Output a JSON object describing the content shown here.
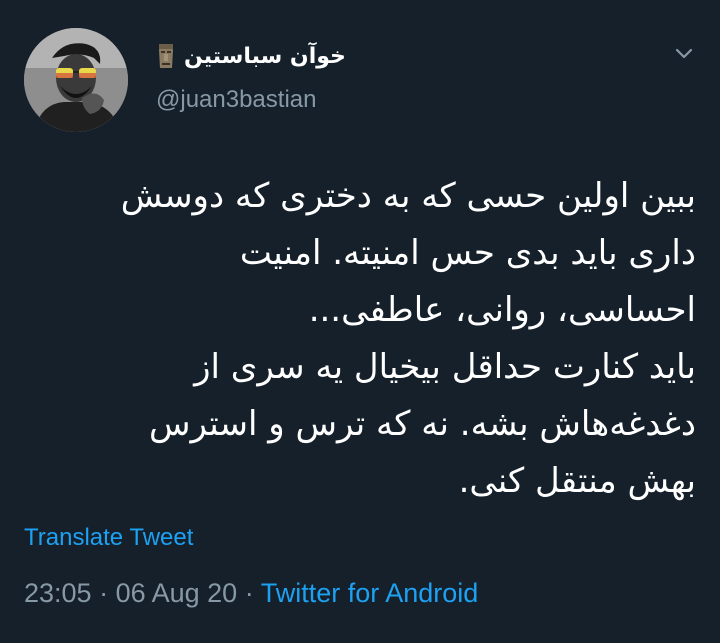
{
  "author": {
    "display_name": "خوآن سباستین",
    "handle": "@juan3bastian",
    "badge_icon": "moai-emoji-icon"
  },
  "tweet": {
    "lines": [
      "ببین اولین حسی که به دختری که دوسش",
      "داری باید بدی حس امنیته. امنیت",
      "احساسی، روانی، عاطفی...",
      "باید کنارت حداقل بیخیال یه سری از",
      "دغدغه‌هاش بشه. نه که ترس و استرس",
      "بهش منتقل کنی."
    ]
  },
  "translate_label": "Translate Tweet",
  "meta": {
    "time": "23:05",
    "separator": " · ",
    "date": "06 Aug 20",
    "source": "Twitter for Android"
  },
  "colors": {
    "background": "#15202b",
    "accent": "#1da1f2",
    "muted": "#8899a6"
  }
}
